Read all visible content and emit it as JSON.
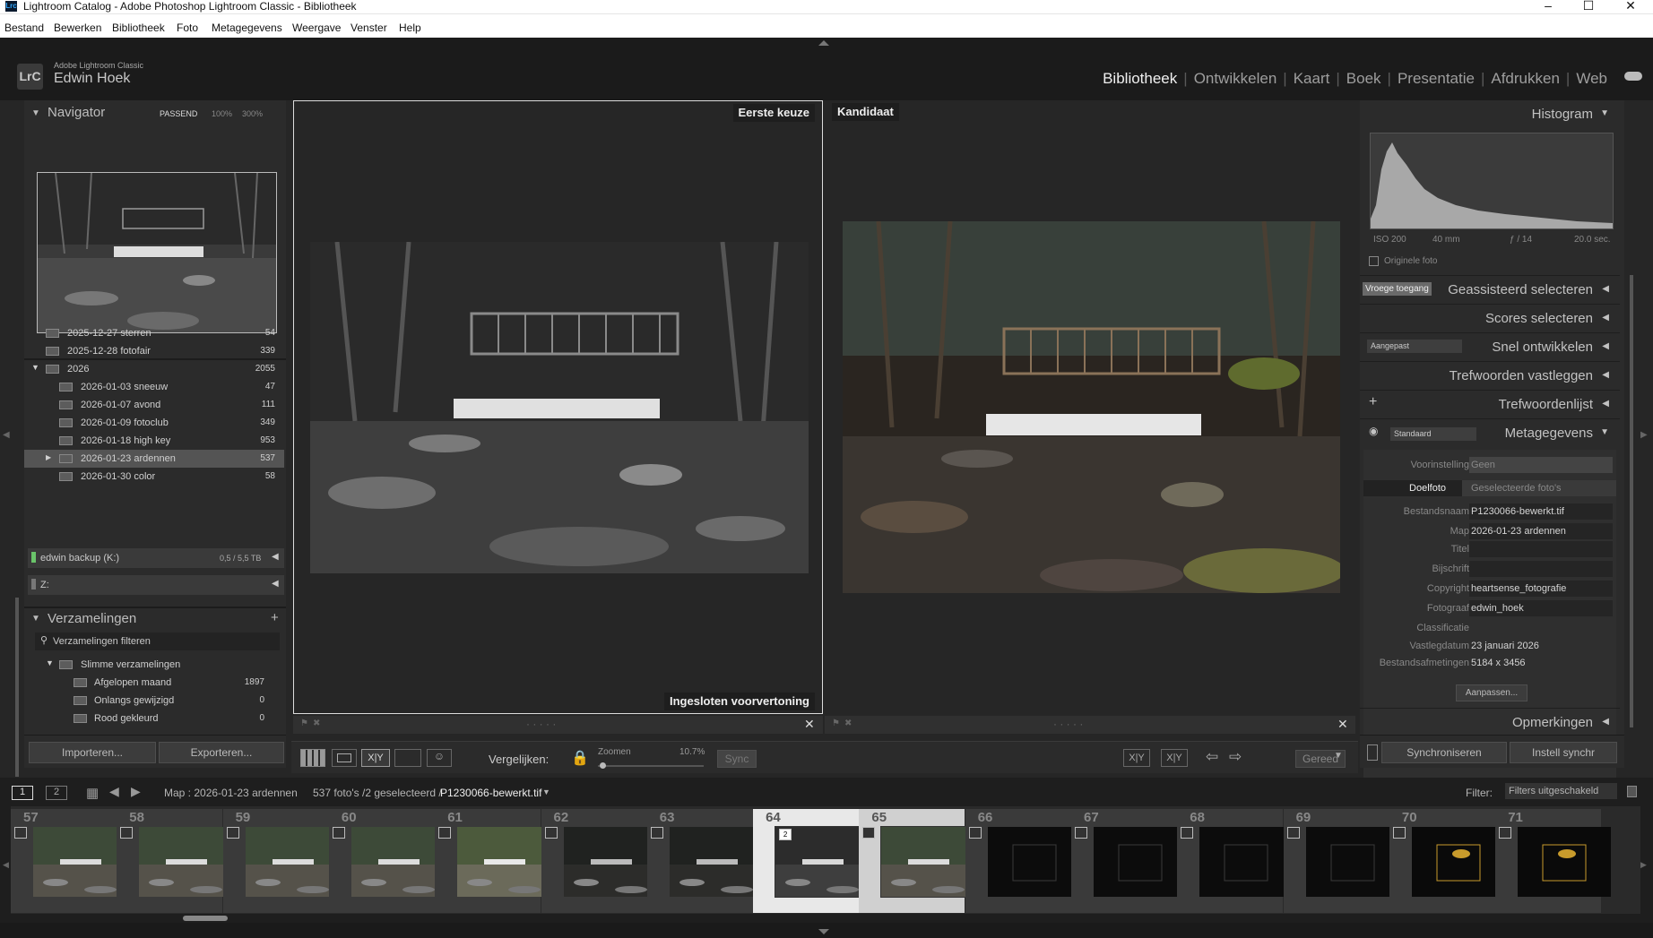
{
  "window": {
    "title": "Lightroom Catalog - Adobe Photoshop Lightroom Classic - Bibliotheek",
    "logo": "Lrc"
  },
  "menu": [
    "Bestand",
    "Bewerken",
    "Bibliotheek",
    "Foto",
    "Metagegevens",
    "Weergave",
    "Venster",
    "Help"
  ],
  "identity": {
    "logo": "LrC",
    "tag": "Adobe Lightroom Classic",
    "user": "Edwin Hoek"
  },
  "modules": [
    "Bibliotheek",
    "Ontwikkelen",
    "Kaart",
    "Boek",
    "Presentatie",
    "Afdrukken",
    "Web"
  ],
  "navigator": {
    "title": "Navigator",
    "fit": "PASSEND",
    "z1": "100%",
    "z2": "300%"
  },
  "folders": [
    {
      "name": "2025-12-27 sterren",
      "count": "54"
    },
    {
      "name": "2025-12-28 fotofair",
      "count": "339"
    },
    {
      "name": "2026",
      "count": "2055"
    },
    {
      "name": "2026-01-03 sneeuw",
      "count": "47"
    },
    {
      "name": "2026-01-07 avond",
      "count": "111"
    },
    {
      "name": "2026-01-09 fotoclub",
      "count": "349"
    },
    {
      "name": "2026-01-18 high key",
      "count": "953"
    },
    {
      "name": "2026-01-23 ardennen",
      "count": "537"
    },
    {
      "name": "2026-01-30 color",
      "count": "58"
    }
  ],
  "volumes": [
    {
      "name": "edwin backup (K:)",
      "size": "0,5 / 5,5 TB"
    },
    {
      "name": "Z:",
      "size": ""
    }
  ],
  "collections": {
    "title": "Verzamelingen",
    "filter": "Verzamelingen filteren",
    "smart": "Slimme verzamelingen",
    "items": [
      {
        "name": "Afgelopen maand",
        "count": "1897"
      },
      {
        "name": "Onlangs gewijzigd",
        "count": "0"
      },
      {
        "name": "Rood gekleurd",
        "count": "0"
      }
    ]
  },
  "compare": {
    "select": "Eerste keuze",
    "candidate": "Kandidaat",
    "locked": "Ingesloten voorvertoning",
    "dots": "· · · · ·"
  },
  "toolbar": {
    "compare_label": "Vergelijken:",
    "zoom_label": "Zoomen",
    "zoom_value": "10.7%",
    "sync": "Sync",
    "done": "Gereed",
    "xy": "X|Y"
  },
  "leftbuttons": {
    "import": "Importeren...",
    "export": "Exporteren..."
  },
  "right": {
    "histogram": "Histogram",
    "hist_info": [
      "ISO 200",
      "40 mm",
      "ƒ / 14",
      "20.0 sec."
    ],
    "original": "Originele foto",
    "early": "Vroege toegang",
    "assisted": "Geassisteerd selecteren",
    "scores": "Scores selecteren",
    "quick_preset": "Aangepast",
    "quick": "Snel ontwikkelen",
    "keywording": "Trefwoorden vastleggen",
    "keywordlist": "Trefwoordenlijst",
    "meta_preset": "Standaard",
    "metadata": "Metagegevens",
    "preset_label": "Voorinstelling",
    "preset_value": "Geen",
    "tab_target": "Doelfoto",
    "tab_selected": "Geselecteerde foto's",
    "fields": [
      {
        "k": "Bestandsnaam",
        "v": "P1230066-bewerkt.tif"
      },
      {
        "k": "Map",
        "v": "2026-01-23 ardennen"
      },
      {
        "k": "Titel",
        "v": ""
      },
      {
        "k": "Bijschrift",
        "v": ""
      },
      {
        "k": "Copyright",
        "v": "heartsense_fotografie"
      },
      {
        "k": "Fotograaf",
        "v": "edwin_hoek"
      },
      {
        "k": "Classificatie",
        "v": ""
      },
      {
        "k": "Vastlegdatum",
        "v": "23 januari 2026"
      },
      {
        "k": "Bestandsafmetingen",
        "v": "5184 x 3456"
      }
    ],
    "customize": "Aanpassen...",
    "comments": "Opmerkingen",
    "sync": "Synchroniseren",
    "sync_settings": "Instell synchr"
  },
  "filmheader": {
    "s1": "1",
    "s2": "2",
    "source": "Map : 2026-01-23 ardennen",
    "count": "537 foto's /2 geselecteerd /",
    "file": "P1230066-bewerkt.tif",
    "filter_label": "Filter:",
    "filter_value": "Filters uitgeschakeld"
  },
  "film": [
    {
      "n": "57",
      "tone": "forest"
    },
    {
      "n": "58",
      "tone": "forest"
    },
    {
      "n": "59",
      "tone": "forest"
    },
    {
      "n": "60",
      "tone": "forest"
    },
    {
      "n": "61",
      "tone": "bright"
    },
    {
      "n": "62",
      "tone": "dark"
    },
    {
      "n": "63",
      "tone": "dark"
    },
    {
      "n": "64",
      "tone": "mono",
      "badge": "2",
      "selected": true
    },
    {
      "n": "65",
      "tone": "forest",
      "selected": true
    },
    {
      "n": "66",
      "tone": "studio"
    },
    {
      "n": "67",
      "tone": "studio"
    },
    {
      "n": "68",
      "tone": "studio"
    },
    {
      "n": "69",
      "tone": "studio"
    },
    {
      "n": "70",
      "tone": "bird"
    },
    {
      "n": "71",
      "tone": "bird"
    }
  ]
}
